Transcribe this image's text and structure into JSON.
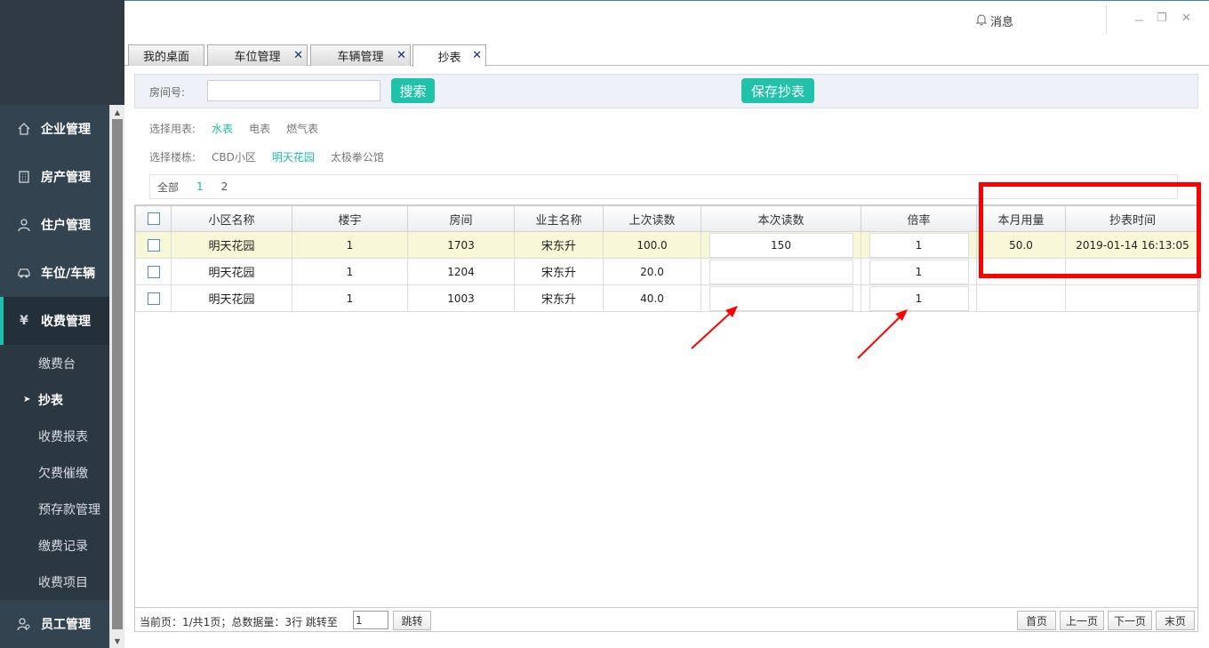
{
  "topbar": {
    "message_label": "消息",
    "win_minimize": "－",
    "win_restore": "❐",
    "win_close": "✕"
  },
  "sidebar": {
    "items": [
      {
        "label": "企业管理",
        "icon": "home-icon"
      },
      {
        "label": "房产管理",
        "icon": "building-icon"
      },
      {
        "label": "住户管理",
        "icon": "user-icon"
      },
      {
        "label": "车位/车辆",
        "icon": "car-icon"
      },
      {
        "label": "收费管理",
        "icon": "yen-icon",
        "active": true
      },
      {
        "label": "员工管理",
        "icon": "staff-icon"
      }
    ],
    "submenu": [
      {
        "label": "缴费台"
      },
      {
        "label": "抄表",
        "active": true
      },
      {
        "label": "收费报表"
      },
      {
        "label": "欠费催缴"
      },
      {
        "label": "预存款管理"
      },
      {
        "label": "缴费记录"
      },
      {
        "label": "收费项目"
      }
    ]
  },
  "tabs": [
    {
      "label": "我的桌面",
      "closable": false
    },
    {
      "label": "车位管理",
      "closable": true
    },
    {
      "label": "车辆管理",
      "closable": true
    },
    {
      "label": "抄表",
      "closable": true,
      "active": true
    }
  ],
  "search": {
    "room_label": "房间号:",
    "room_value": "",
    "search_button": "搜索",
    "save_button": "保存抄表"
  },
  "filters": {
    "meter_label": "选择用表:",
    "meter_options": [
      "水表",
      "电表",
      "燃气表"
    ],
    "meter_selected": "水表",
    "building_label": "选择楼栋:",
    "building_options": [
      "CBD小区",
      "明天花园",
      "太极拳公馆"
    ],
    "building_selected": "明天花园",
    "unit_tabs": [
      "全部",
      "1",
      "2"
    ],
    "unit_selected": "1"
  },
  "table": {
    "headers": [
      "小区名称",
      "楼宇",
      "房间",
      "业主名称",
      "上次读数",
      "本次读数",
      "倍率",
      "本月用量",
      "抄表时间"
    ],
    "rows": [
      {
        "community": "明天花园",
        "building": "1",
        "room": "1703",
        "owner": "宋东升",
        "last": "100.0",
        "current": "150",
        "rate": "1",
        "usage": "50.0",
        "time": "2019-01-14 16:13:05"
      },
      {
        "community": "明天花园",
        "building": "1",
        "room": "1204",
        "owner": "宋东升",
        "last": "20.0",
        "current": "",
        "rate": "1",
        "usage": "",
        "time": ""
      },
      {
        "community": "明天花园",
        "building": "1",
        "room": "1003",
        "owner": "宋东升",
        "last": "40.0",
        "current": "",
        "rate": "1",
        "usage": "",
        "time": ""
      }
    ]
  },
  "footer": {
    "info": "当前页：1/共1页；总数据量：3行   跳转至",
    "jump_value": "1",
    "jump_button": "跳转",
    "first": "首页",
    "prev": "上一页",
    "next": "下一页",
    "last": "末页"
  },
  "colors": {
    "accent": "#20c2aa",
    "sidebar": "#344350",
    "annotation": "#ff0000"
  }
}
